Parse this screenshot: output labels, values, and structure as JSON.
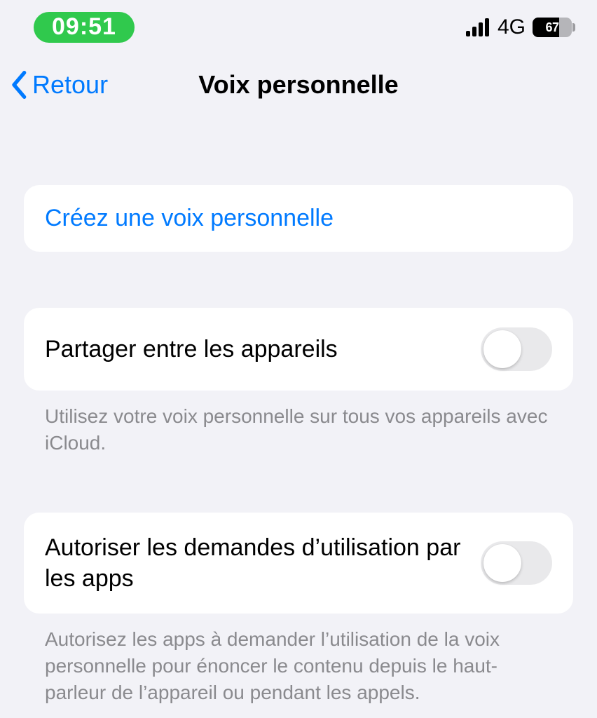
{
  "status": {
    "time": "09:51",
    "network_type": "4G",
    "battery_percent": "67"
  },
  "nav": {
    "back_label": "Retour",
    "title": "Voix personnelle"
  },
  "sections": {
    "create": {
      "link_label": "Créez une voix personnelle"
    },
    "share": {
      "label": "Partager entre les appareils",
      "toggle_on": false,
      "footer": "Utilisez votre voix personnelle sur tous vos appareils avec iCloud."
    },
    "allow_apps": {
      "label": "Autoriser les demandes d’utilisation par les apps",
      "toggle_on": false,
      "footer": "Autorisez les apps à demander l’utilisation de la voix personnelle pour énoncer le contenu depuis le haut-parleur de l’appareil ou pendant les appels."
    }
  }
}
